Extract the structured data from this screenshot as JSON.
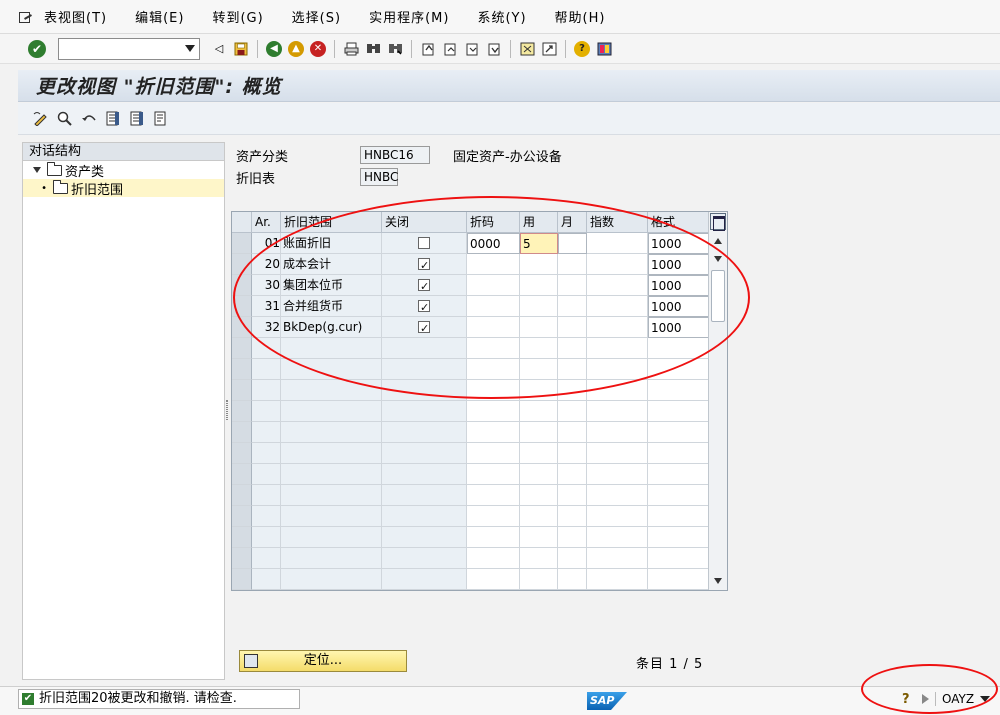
{
  "menu": [
    "表视图(T)",
    "编辑(E)",
    "转到(G)",
    "选择(S)",
    "实用程序(M)",
    "系统(Y)",
    "帮助(H)"
  ],
  "toolbar": {
    "command_value": ""
  },
  "title": "更改视图 \"折旧范围\": 概览",
  "tree": {
    "header": "对话结构",
    "items": [
      {
        "label": "资产类",
        "level": 0
      },
      {
        "label": "折旧范围",
        "level": 1
      }
    ]
  },
  "fields": {
    "asset_class_label": "资产分类",
    "asset_class_value": "HNBC16",
    "asset_class_desc": "固定资产-办公设备",
    "dep_table_label": "折旧表",
    "dep_table_value": "HNBC"
  },
  "table": {
    "columns": [
      "Ar.",
      "折旧范围",
      "关闭",
      "折码",
      "用",
      "月",
      "指数",
      "格式"
    ],
    "rows": [
      {
        "ar": "01",
        "name": "账面折旧",
        "closed": false,
        "key": "0000",
        "use": "5",
        "month": "",
        "index": "",
        "layout": "1000"
      },
      {
        "ar": "20",
        "name": "成本会计",
        "closed": true,
        "key": "",
        "use": "",
        "month": "",
        "index": "",
        "layout": "1000"
      },
      {
        "ar": "30",
        "name": "集团本位币",
        "closed": true,
        "key": "",
        "use": "",
        "month": "",
        "index": "",
        "layout": "1000"
      },
      {
        "ar": "31",
        "name": "合并组货币",
        "closed": true,
        "key": "",
        "use": "",
        "month": "",
        "index": "",
        "layout": "1000"
      },
      {
        "ar": "32",
        "name": "BkDep(g.cur)",
        "closed": true,
        "key": "",
        "use": "",
        "month": "",
        "index": "",
        "layout": "1000"
      }
    ],
    "empty_rows": 12
  },
  "position_button": "定位...",
  "entry_info": "条目 1 / 5",
  "status": {
    "message": "折旧范围20被更改和撤销. 请检查.",
    "logo": "SAP",
    "system": "OAYZ"
  }
}
